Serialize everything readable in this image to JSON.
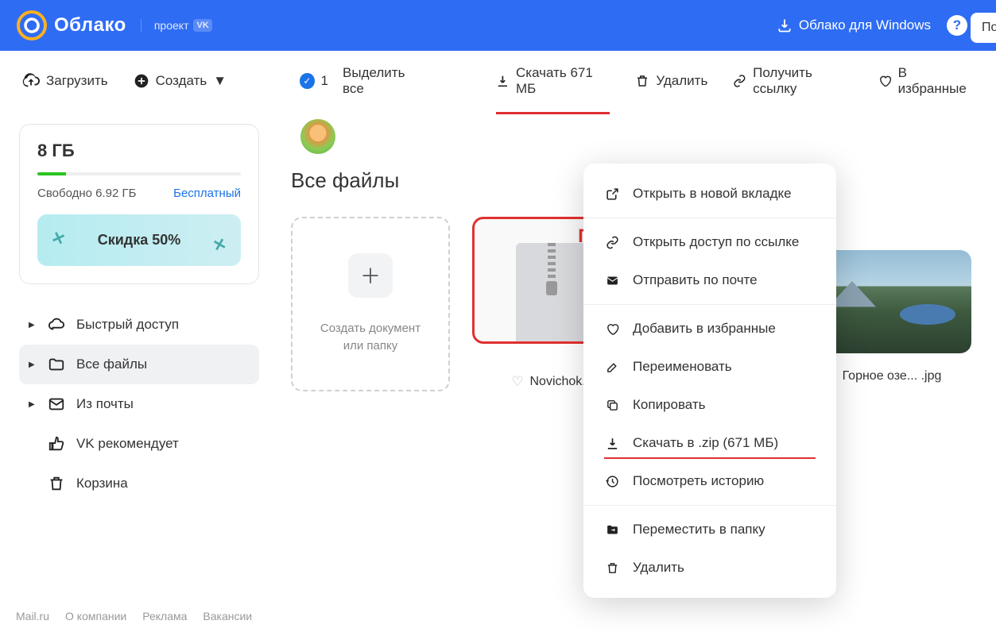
{
  "header": {
    "logo_text": "Облако",
    "project": "проект",
    "project_badge": "VK",
    "windows_btn": "Облако для Windows",
    "help": "?",
    "search": "По"
  },
  "toolbar": {
    "upload": "Загрузить",
    "create": "Создать",
    "selected_count": "1",
    "select_all": "Выделить все",
    "download": "Скачать 671 МБ",
    "delete": "Удалить",
    "get_link": "Получить ссылку",
    "favorites": "В избранные"
  },
  "storage": {
    "total": "8 ГБ",
    "free": "Свободно 6.92 ГБ",
    "plan": "Бесплатный",
    "promo": "Скидка 50%"
  },
  "nav": {
    "quick": "Быстрый доступ",
    "all": "Все файлы",
    "mail": "Из почты",
    "vk": "VK рекомендует",
    "trash": "Корзина"
  },
  "main": {
    "title": "Все файлы",
    "create_tile_l1": "Создать документ",
    "create_tile_l2": "или папку",
    "zip_label": "ПКМ",
    "zip_name": "Novichok.z",
    "img_name": "Горное озе... .jpg"
  },
  "context": {
    "open_tab": "Открыть в новой вкладке",
    "share_link": "Открыть доступ по ссылке",
    "send_mail": "Отправить по почте",
    "add_fav": "Добавить в избранные",
    "rename": "Переименовать",
    "copy": "Копировать",
    "download_zip": "Скачать в .zip (671 МБ)",
    "history": "Посмотреть историю",
    "move": "Переместить в папку",
    "delete": "Удалить"
  },
  "footer": {
    "mail": "Mail.ru",
    "about": "О компании",
    "ads": "Реклама",
    "jobs": "Вакансии"
  }
}
